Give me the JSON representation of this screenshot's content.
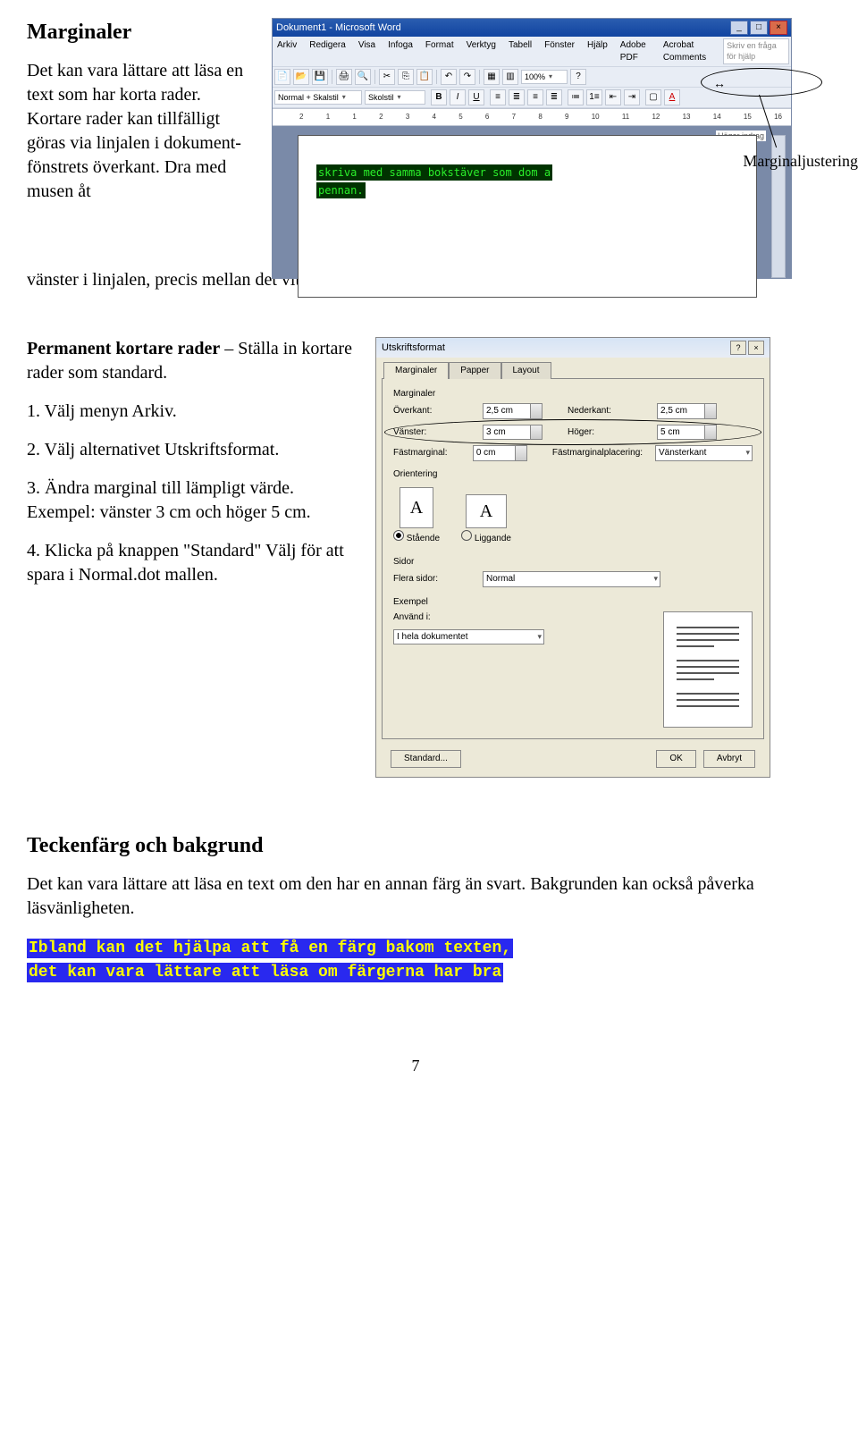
{
  "section1": {
    "heading": "Marginaler",
    "para": "Det kan vara lättare att läsa en text som har korta rader. Kortare rader kan tillfälligt göras via linjalen i dokument-fönstrets överkant. Dra med musen åt vänster i linjalen, precis mellan det vita och blå fältet för att få kortare rader.",
    "para_left": "Det kan vara lättare att läsa en text som har korta rader. Kortare rader kan tillfälligt göras via linjalen i dokument-fönstrets överkant. Dra med musen åt",
    "para_tail": "vänster i linjalen, precis mellan det vita och blå fältet för att få kortare rader."
  },
  "word": {
    "title": "Dokument1 - Microsoft Word",
    "menus": [
      "Arkiv",
      "Redigera",
      "Visa",
      "Infoga",
      "Format",
      "Verktyg",
      "Tabell",
      "Fönster",
      "Hjälp",
      "Adobe PDF",
      "Acrobat Comments"
    ],
    "help_placeholder": "Skriv en fråga för hjälp",
    "style": "Normal + Skalstil",
    "font": "Skolstil",
    "zoom": "100%",
    "ruler_numbers": [
      "2",
      "1",
      "1",
      "2",
      "3",
      "4",
      "5",
      "6",
      "7",
      "8",
      "9",
      "10",
      "11",
      "12",
      "13",
      "14",
      "15",
      "16"
    ],
    "margin_label": "Höger indrag",
    "line1": "skriva med samma bokstäver som dom a",
    "line2": "pennan."
  },
  "callout_label": "Marginaljustering",
  "section2": {
    "heading_bold": "Permanent kortare rader",
    "heading_rest": " – Ställa in kortare rader som standard.",
    "step1": "1. Välj menyn Arkiv.",
    "step2": "2. Välj alternativet Utskriftsformat.",
    "step3a": "3. Ändra marginal till lämpligt värde.",
    "step3b": "Exempel: vänster 3 cm och höger 5 cm.",
    "step4": "4. Klicka på knappen \"Standard\" Välj för att spara i Normal.dot mallen."
  },
  "dialog": {
    "title": "Utskriftsformat",
    "tabs": [
      "Marginaler",
      "Papper",
      "Layout"
    ],
    "group_marg": "Marginaler",
    "labels": {
      "over": "Överkant:",
      "ned": "Nederkant:",
      "van": "Vänster:",
      "hog": "Höger:",
      "fast": "Fästmarginal:",
      "fastpl": "Fästmarginalplacering:"
    },
    "vals": {
      "over": "2,5 cm",
      "ned": "2,5 cm",
      "van": "3 cm",
      "hog": "5 cm",
      "fast": "0 cm",
      "fastpl": "Vänsterkant"
    },
    "group_or": "Orientering",
    "portrait": "Stående",
    "landscape": "Liggande",
    "group_sid": "Sidor",
    "sid_label": "Flera sidor:",
    "sid_val": "Normal",
    "group_ex": "Exempel",
    "apply_label": "Använd i:",
    "apply_val": "I hela dokumentet",
    "btn_std": "Standard...",
    "btn_ok": "OK",
    "btn_cancel": "Avbryt"
  },
  "section3": {
    "heading": "Teckenfärg och bakgrund",
    "para": "Det kan vara lättare att läsa en text om den har en annan färg än svart. Bakgrunden kan också påverka läsvänligheten.",
    "hl1": "Ibland kan det hjälpa att få en färg bakom texten,",
    "hl2": "det kan vara lättare att läsa om färgerna har bra"
  },
  "page_number": "7"
}
